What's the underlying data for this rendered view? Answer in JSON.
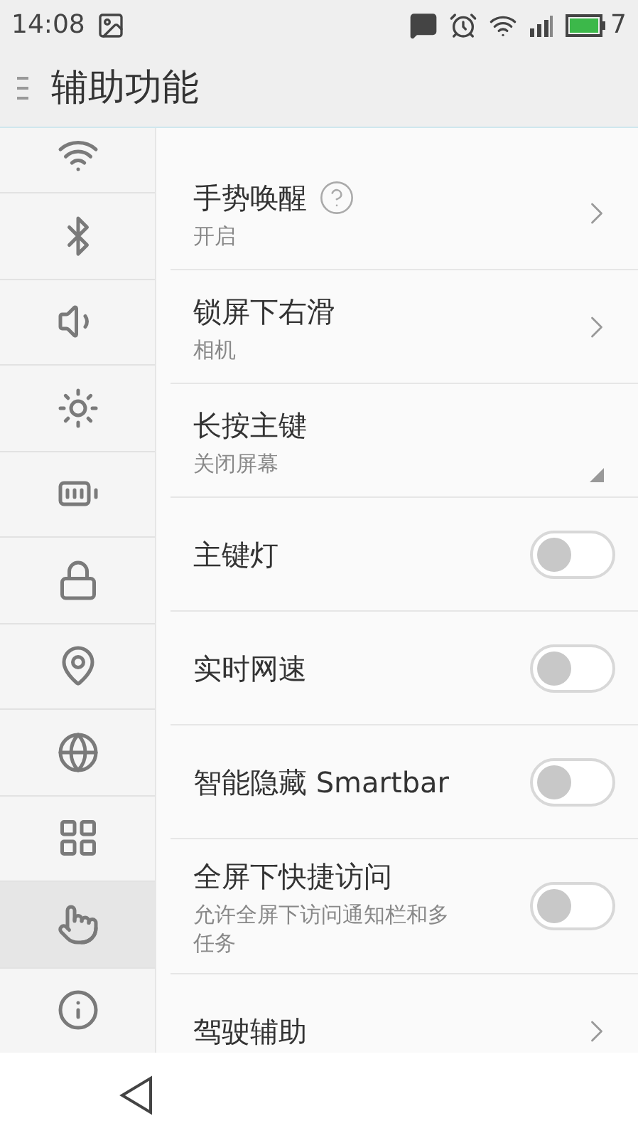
{
  "status_bar": {
    "time": "14:08",
    "battery": "7"
  },
  "header": {
    "title": "辅助功能"
  },
  "sidebar": {
    "items": [
      {
        "selected": false
      },
      {
        "selected": false
      },
      {
        "selected": false
      },
      {
        "selected": false
      },
      {
        "selected": false
      },
      {
        "selected": false
      },
      {
        "selected": false
      },
      {
        "selected": false
      },
      {
        "selected": false
      },
      {
        "selected": true
      },
      {
        "selected": false
      }
    ]
  },
  "settings": [
    {
      "kind": "link",
      "title": "手势唤醒",
      "help": true,
      "subtitle": "开启"
    },
    {
      "kind": "link",
      "title": "锁屏下右滑",
      "subtitle": "相机"
    },
    {
      "kind": "dropdown",
      "title": "长按主键",
      "subtitle": "关闭屏幕"
    },
    {
      "kind": "toggle",
      "title": "主键灯",
      "on": false
    },
    {
      "kind": "toggle",
      "title": "实时网速",
      "on": false
    },
    {
      "kind": "toggle",
      "title": "智能隐藏 Smartbar",
      "on": false
    },
    {
      "kind": "toggle",
      "title": "全屏下快捷访问",
      "subtitle": "允许全屏下访问通知栏和多任务",
      "on": false
    },
    {
      "kind": "link",
      "title": "驾驶辅助"
    }
  ]
}
